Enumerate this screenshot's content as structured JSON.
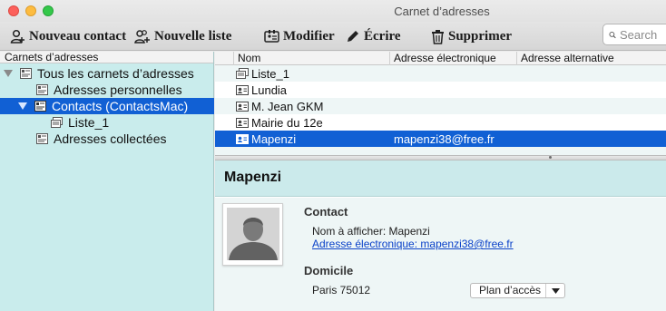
{
  "window": {
    "title": "Carnet d’adresses"
  },
  "toolbar": {
    "new_contact": "Nouveau contact",
    "new_list": "Nouvelle liste",
    "edit": "Modifier",
    "write": "Écrire",
    "delete": "Supprimer",
    "search_placeholder": "Search"
  },
  "sidebar": {
    "header": "Carnets d’adresses",
    "items": [
      {
        "label": "Tous les carnets d’adresses",
        "icon": "address-book-icon",
        "expanded": true
      },
      {
        "label": "Adresses personnelles",
        "icon": "address-book-icon"
      },
      {
        "label": "Contacts (ContactsMac)",
        "icon": "address-book-icon",
        "expanded": true,
        "selected": true
      },
      {
        "label": "Liste_1",
        "icon": "mailing-list-icon"
      },
      {
        "label": "Adresses collectées",
        "icon": "address-book-icon"
      }
    ]
  },
  "list": {
    "columns": [
      "Nom",
      "Adresse électronique",
      "Adresse alternative"
    ],
    "rows": [
      {
        "name": "Liste_1",
        "email": "",
        "alt": "",
        "icon": "mailing-list-icon"
      },
      {
        "name": "Lundia",
        "email": "",
        "alt": "",
        "icon": "contact-card-icon"
      },
      {
        "name": "M. Jean GKM",
        "email": "",
        "alt": "",
        "icon": "contact-card-icon"
      },
      {
        "name": "Mairie du 12e",
        "email": "",
        "alt": "",
        "icon": "contact-card-icon"
      },
      {
        "name": "Mapenzi",
        "email": "mapenzi38@free.fr",
        "alt": "",
        "icon": "contact-card-icon",
        "selected": true
      }
    ]
  },
  "detail": {
    "name": "Mapenzi",
    "contact_section": "Contact",
    "display_name_line": "Nom à afficher: Mapenzi",
    "email_line": "Adresse électronique: mapenzi38@free.fr",
    "home_section": "Domicile",
    "city_line": "Paris 75012",
    "map_button": "Plan d’accès"
  },
  "colors": {
    "sidebar_bg": "#c9ecec",
    "selection": "#1160d4",
    "link": "#0b42c9",
    "detail_header": "#cbeaeb"
  }
}
